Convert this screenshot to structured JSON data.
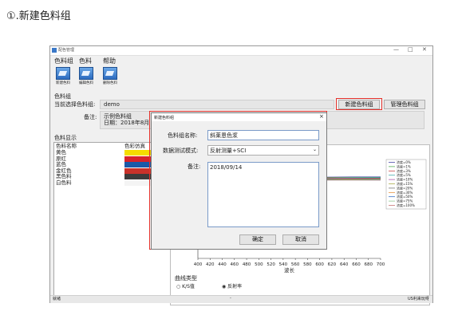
{
  "heading": "①.新建色料组",
  "window": {
    "title": "配色管理",
    "controls": [
      "—",
      "□",
      "✕"
    ],
    "menu": [
      "色料组",
      "色料",
      "帮助"
    ],
    "toolbar": [
      {
        "label": "新建色料",
        "icon": "new-colorant-icon"
      },
      {
        "label": "编辑色料",
        "icon": "edit-colorant-icon"
      },
      {
        "label": "删除色料",
        "icon": "delete-colorant-icon"
      }
    ],
    "group_section": "色料组",
    "current_group_label": "当前选择色料组:",
    "current_group_value": "demo",
    "new_group_button": "新建色料组",
    "manage_group_button": "管理色料组",
    "remark_label": "备注:",
    "remark_line1": "示例色料组",
    "remark_line2": "日期：2018年8月",
    "display_section": "色料显示",
    "list_headers": [
      "色料名称",
      "色彩仿真"
    ],
    "colorants": [
      {
        "name": "黄色",
        "color": "#f5dc00"
      },
      {
        "name": "原红",
        "color": "#d8232a"
      },
      {
        "name": "蓝色",
        "color": "#1a5aa8"
      },
      {
        "name": "金红色",
        "color": "#c8322a"
      },
      {
        "name": "黑色料",
        "color": "#3c3c3c"
      },
      {
        "name": "白色料",
        "color": "#f4f4f4"
      }
    ],
    "status_left": "就绪",
    "status_mid": "-",
    "status_right": "US利来玩呀"
  },
  "chart_data": {
    "type": "line",
    "xlabel": "波长",
    "x_ticks": [
      "400",
      "420",
      "440",
      "460",
      "480",
      "500",
      "520",
      "540",
      "560",
      "580",
      "600",
      "620",
      "640",
      "660",
      "680",
      "700"
    ],
    "xlim": [
      400,
      700
    ],
    "legend": [
      "浓度=0%",
      "浓度=1%",
      "浓度=3%",
      "浓度=5%",
      "浓度=10%",
      "浓度=15%",
      "浓度=20%",
      "浓度=30%",
      "浓度=50%",
      "浓度=75%",
      "浓度=100%"
    ],
    "legend_colors": [
      "#2a2a9a",
      "#3aa03a",
      "#c03030",
      "#30a0a0",
      "#a040a0",
      "#a0a030",
      "#606060",
      "#e08020",
      "#2060c0",
      "#80c080",
      "#c06060"
    ],
    "curve_type_label": "曲线类型",
    "curve_options": [
      "K/S值",
      "反射率"
    ],
    "selected_curve": "反射率"
  },
  "dialog": {
    "title": "新建色料组",
    "name_label": "色料组名称:",
    "name_value": "斜莱恩色浆",
    "mode_label": "数据测试模式:",
    "mode_value": "反射测量+SCI",
    "remark_label": "备注:",
    "remark_value": "2018/09/14",
    "ok_button": "确定",
    "cancel_button": "取消"
  }
}
